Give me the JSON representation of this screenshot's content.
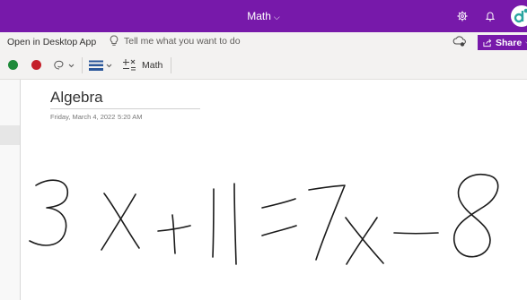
{
  "titlebar": {
    "doc_title": "Math",
    "chevron": "⌵",
    "background": "#7719aa",
    "icons": [
      "gear-icon",
      "bell-icon",
      "avatar"
    ]
  },
  "menubar": {
    "open_desktop": "Open in Desktop App",
    "tell_me": "Tell me what you want to do",
    "share_label": "Share"
  },
  "ribbon": {
    "math_label": "Math",
    "pen_colors": [
      "#1e8a3a",
      "#c4202a"
    ]
  },
  "page": {
    "title": "Algebra",
    "date": "Friday, March 4, 2022",
    "time": "5:20 AM",
    "handwriting": "3x+11=7x-8"
  }
}
